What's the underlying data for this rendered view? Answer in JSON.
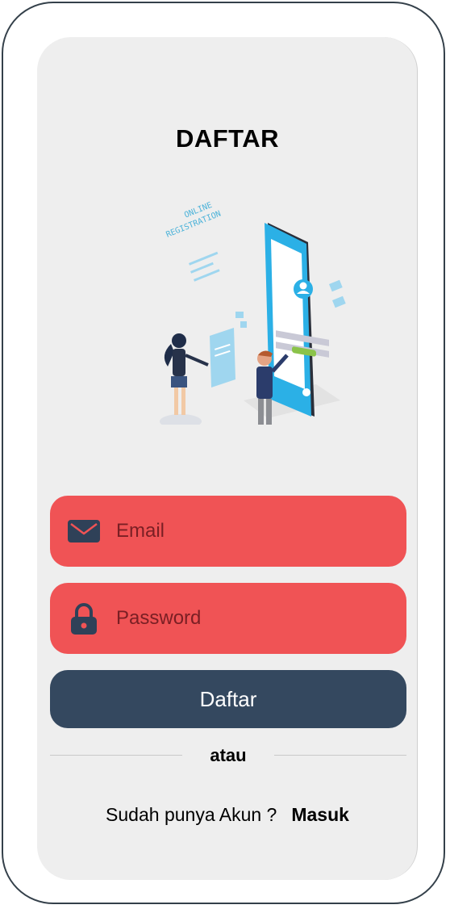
{
  "screen": {
    "title": "DAFTAR"
  },
  "illustration": {
    "icon": "online-registration-illustration",
    "caption_line1": "ONLINE",
    "caption_line2": "REGISTRATION"
  },
  "form": {
    "email": {
      "placeholder": "Email",
      "icon": "envelope-icon"
    },
    "password": {
      "placeholder": "Password",
      "icon": "lock-icon"
    },
    "submit_label": "Daftar"
  },
  "divider": {
    "text": "atau"
  },
  "footer": {
    "prompt": "Sudah punya Akun ?",
    "login_link": "Masuk"
  },
  "colors": {
    "field_background": "#f05355",
    "button_background": "#34485f",
    "screen_background": "#eeeeee",
    "icon_color": "#2f4158"
  }
}
